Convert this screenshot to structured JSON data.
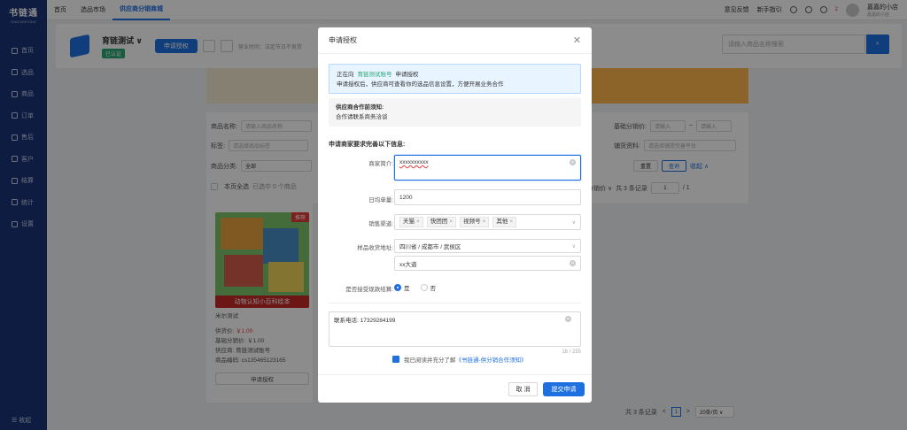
{
  "app": {
    "logo": "书链通",
    "logo_sub": "SHULIANTONG"
  },
  "sidebar": {
    "items": [
      {
        "label": "首页"
      },
      {
        "label": "选品"
      },
      {
        "label": "商品"
      },
      {
        "label": "订单"
      },
      {
        "label": "售后"
      },
      {
        "label": "客户"
      },
      {
        "label": "结算"
      },
      {
        "label": "统计"
      },
      {
        "label": "设置"
      }
    ],
    "collapse": "收起"
  },
  "topnav": {
    "tabs": [
      "首页",
      "选品市场",
      "供应商分销商城"
    ],
    "active": 2
  },
  "topright": {
    "feedback": "意见反馈",
    "guide": "新手指引",
    "notif_count": "2",
    "user_name": "嘉嘉的小店",
    "user_sub": "嘉嘉的小店"
  },
  "supplier": {
    "name": "育链测试 ∨",
    "verified": "已认证",
    "apply_btn": "申请授权",
    "biz_time": "营业时间：法定节日不发货"
  },
  "search": {
    "placeholder": "请输入商品名称搜索"
  },
  "filters": {
    "product_name": "商品名称:",
    "product_name_ph": "请输入商品名称",
    "tags": "标签:",
    "tags_ph": "请选择商品标签",
    "category": "商品分类:",
    "category_val": "全部",
    "base_price": "基础分销价:",
    "base_ph": "请输入",
    "dash": "~",
    "supply_info": "铺货资料:",
    "supply_ph": "请选择铺货完善平台",
    "reset": "重置",
    "query": "查询",
    "collapse": "收起 ∧",
    "select_all": "本页全选",
    "selected": "已选中 0 个商品",
    "sort": "分销价 ∨",
    "total": "共 3 条记录",
    "page": "1",
    "pages": "/ 1"
  },
  "product": {
    "badge": "推荐",
    "cover_caption": "动物认知小百科绘本",
    "name": "米尔测试",
    "supply_price_label": "供货价:",
    "supply_price": "￥1.00",
    "base_label": "基础分销价:",
    "base_price": "￥1.00",
    "supplier_label": "供应商:",
    "supplier": "育链测试账号",
    "code_label": "商品编码:",
    "code": "cs135465123165",
    "apply": "申请授权"
  },
  "pagination": {
    "total": "共 3 条记录",
    "prev": "<",
    "page": "1",
    "next": ">",
    "size": "20条/页 ∨"
  },
  "modal": {
    "title": "申请授权",
    "info_prefix": "正在向",
    "info_name": "育链测试账号",
    "info_suffix": "申请授权",
    "info_desc": "申请授权后，供应商可查看你的选品信息设置，方便开展业务合作",
    "notice_title": "供应商合作前须知:",
    "notice_text": "合作请联系商务洽谈",
    "section": "申请商家要求完善以下信息:",
    "intro_label": "商家简介:",
    "intro_value": "xxxxxxxxxx",
    "daily_label": "日均单量:",
    "daily_value": "1200",
    "channel_label": "销售渠道:",
    "channels": [
      "天猫",
      "快团团",
      "视频号",
      "其他"
    ],
    "addr_label": "样品收货地址:",
    "addr_region": "四川省 / 成都市 / 武侯区",
    "addr_detail": "xx大道",
    "cod_label": "是否接受现款结算:",
    "cod_yes": "是",
    "cod_no": "否",
    "contact": "联系电话: 17329284199",
    "count": "16 / 255",
    "agree_text": "我已阅读并充分了解",
    "agree_link": "《书链通-供分销合作须知》",
    "cancel": "取 消",
    "submit": "提交申请"
  }
}
